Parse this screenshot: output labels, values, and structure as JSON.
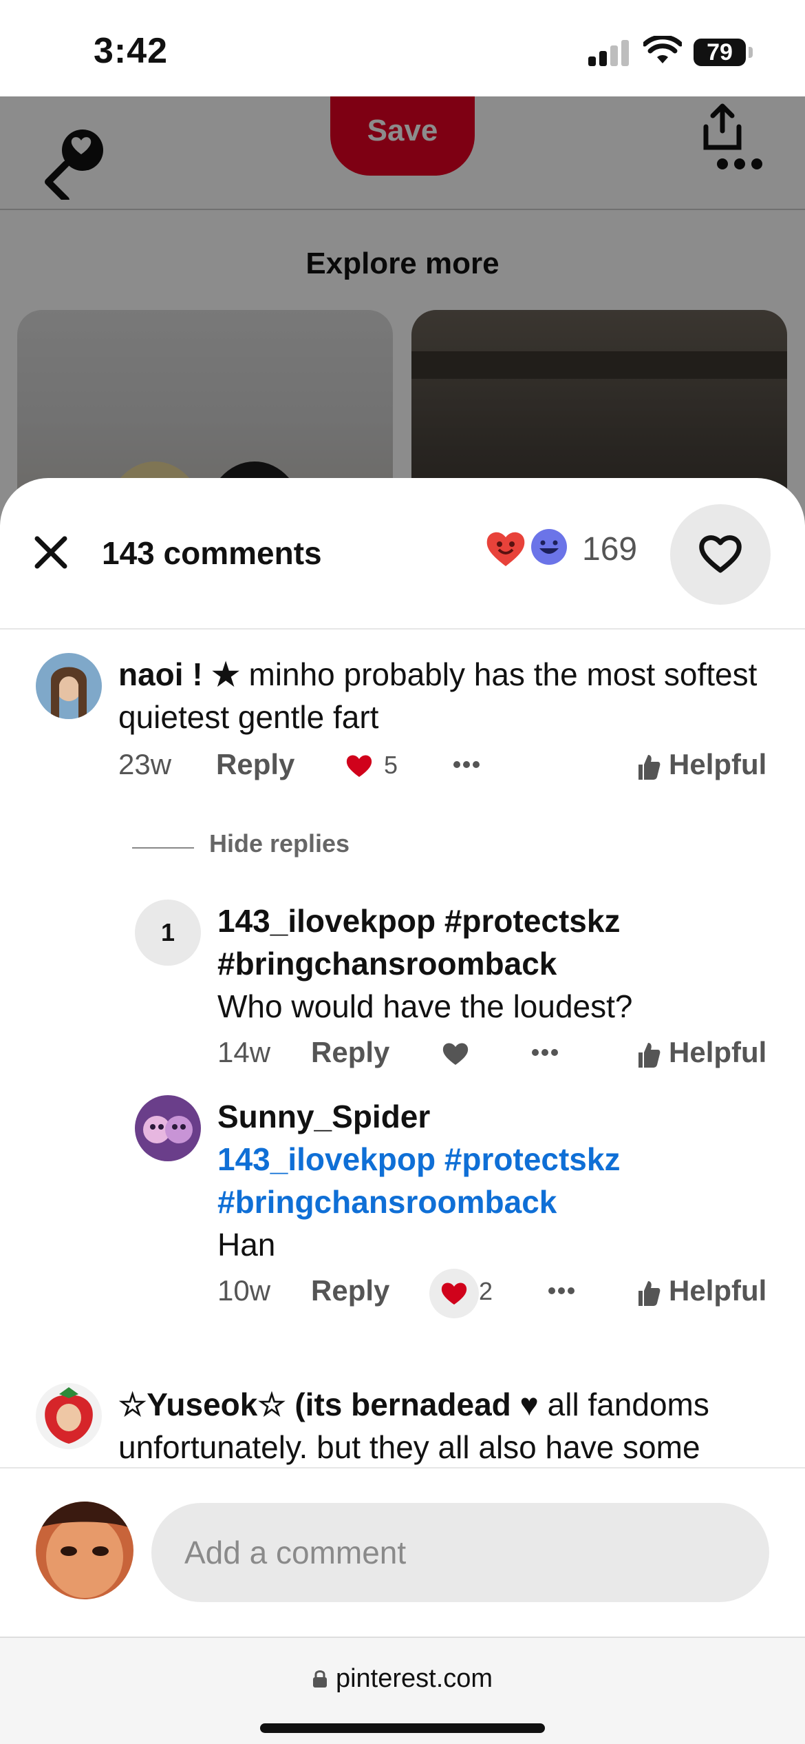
{
  "status_bar": {
    "time": "3:42",
    "battery": "79"
  },
  "top_bar": {
    "save_label": "Save"
  },
  "explore": {
    "title": "Explore more"
  },
  "sheet": {
    "comments_count": "143 comments",
    "reactions_count": "169"
  },
  "comments": [
    {
      "author": "naoi ! ★",
      "text": " minho probably has the most softest quietest gentle fart",
      "age": "23w",
      "reply_label": "Reply",
      "likes": "5",
      "helpful_label": "Helpful"
    }
  ],
  "replies_toggle": "Hide replies",
  "replies": [
    {
      "badge": "1",
      "author": "143_ilovekpop #protectskz #bringchansroomback",
      "text": "Who would have the loudest?",
      "age": "14w",
      "reply_label": "Reply",
      "helpful_label": "Helpful"
    },
    {
      "author": "Sunny_Spider",
      "mention": "143_ilovekpop #protectskz #bringchansroomback",
      "text": "Han",
      "age": "10w",
      "reply_label": "Reply",
      "likes": "2",
      "helpful_label": "Helpful"
    }
  ],
  "next_comment": {
    "author": "☆Yuseok☆ (its bernadead ♥",
    "text": " all fandoms unfortunately. but they all also have some"
  },
  "composer": {
    "placeholder": "Add a comment"
  },
  "browser": {
    "url": "pinterest.com"
  },
  "colors": {
    "brand_red": "#e60023",
    "mention_blue": "#0f6fd6",
    "heart_red": "#d0021b"
  }
}
